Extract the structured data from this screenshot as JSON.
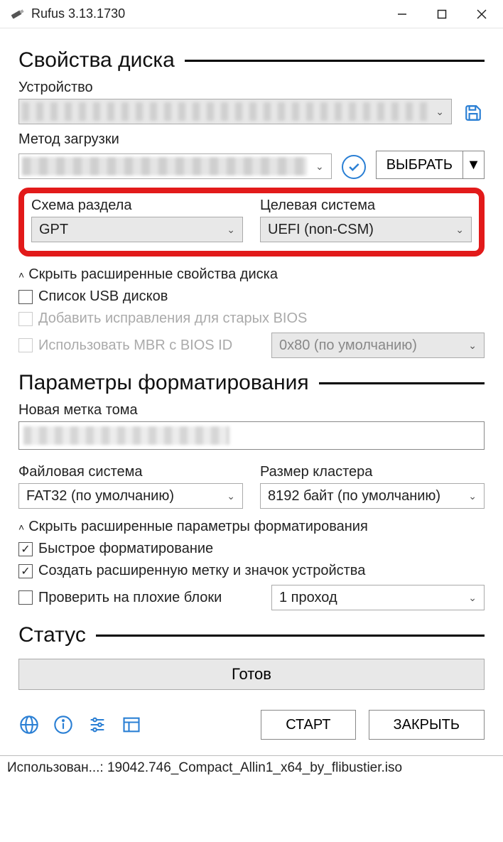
{
  "window": {
    "title": "Rufus 3.13.1730"
  },
  "sections": {
    "drive_props": "Свойства диска",
    "format_opts": "Параметры форматирования",
    "status": "Статус"
  },
  "labels": {
    "device": "Устройство",
    "boot_method": "Метод загрузки",
    "partition_scheme": "Схема раздела",
    "target_system": "Целевая система",
    "hide_drive_adv": "Скрыть расширенные свойства диска",
    "usb_list": "Список USB дисков",
    "old_bios_fix": "Добавить исправления для старых BIOS",
    "use_mbr_biosid": "Использовать MBR с BIOS ID",
    "volume_label": "Новая метка тома",
    "filesystem": "Файловая система",
    "cluster_size": "Размер кластера",
    "hide_format_adv": "Скрыть расширенные параметры форматирования",
    "quick_format": "Быстрое форматирование",
    "ext_label_icon": "Создать расширенную метку и значок устройства",
    "bad_blocks": "Проверить на плохие блоки"
  },
  "values": {
    "partition_scheme": "GPT",
    "target_system": "UEFI (non-CSM)",
    "bios_id": "0x80 (по умолчанию)",
    "filesystem": "FAT32 (по умолчанию)",
    "cluster_size": "8192 байт (по умолчанию)",
    "bad_blocks_passes": "1 проход",
    "status_text": "Готов"
  },
  "buttons": {
    "select": "ВЫБРАТЬ",
    "start": "СТАРТ",
    "close": "ЗАКРЫТЬ"
  },
  "footer": {
    "text": "Использован...: 19042.746_Compact_Allin1_x64_by_flibustier.iso"
  }
}
